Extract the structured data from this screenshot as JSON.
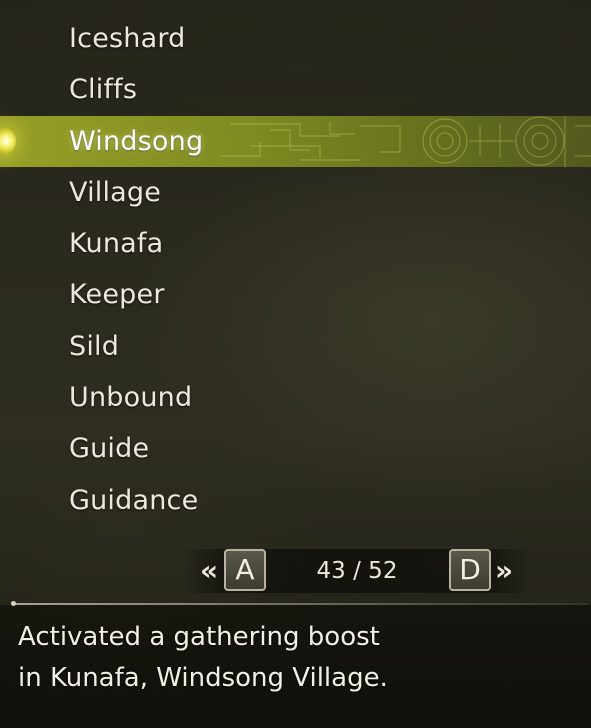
{
  "word_list": {
    "items": [
      "Iceshard",
      "Cliffs",
      "Windsong",
      "Village",
      "Kunafa",
      "Keeper",
      "Sild",
      "Unbound",
      "Guide",
      "Guidance"
    ],
    "selected_index": 2
  },
  "pager": {
    "prev_key": "A",
    "next_key": "D",
    "prev_chevron": "«",
    "next_chevron": "»",
    "current_page": 43,
    "total_pages": 52,
    "page_text": "43 / 52"
  },
  "message": {
    "line1": "Activated a gathering boost",
    "line2": "in Kunafa, Windsong Village."
  },
  "colors": {
    "highlight": "#a8b428",
    "text": "#ece8df"
  }
}
